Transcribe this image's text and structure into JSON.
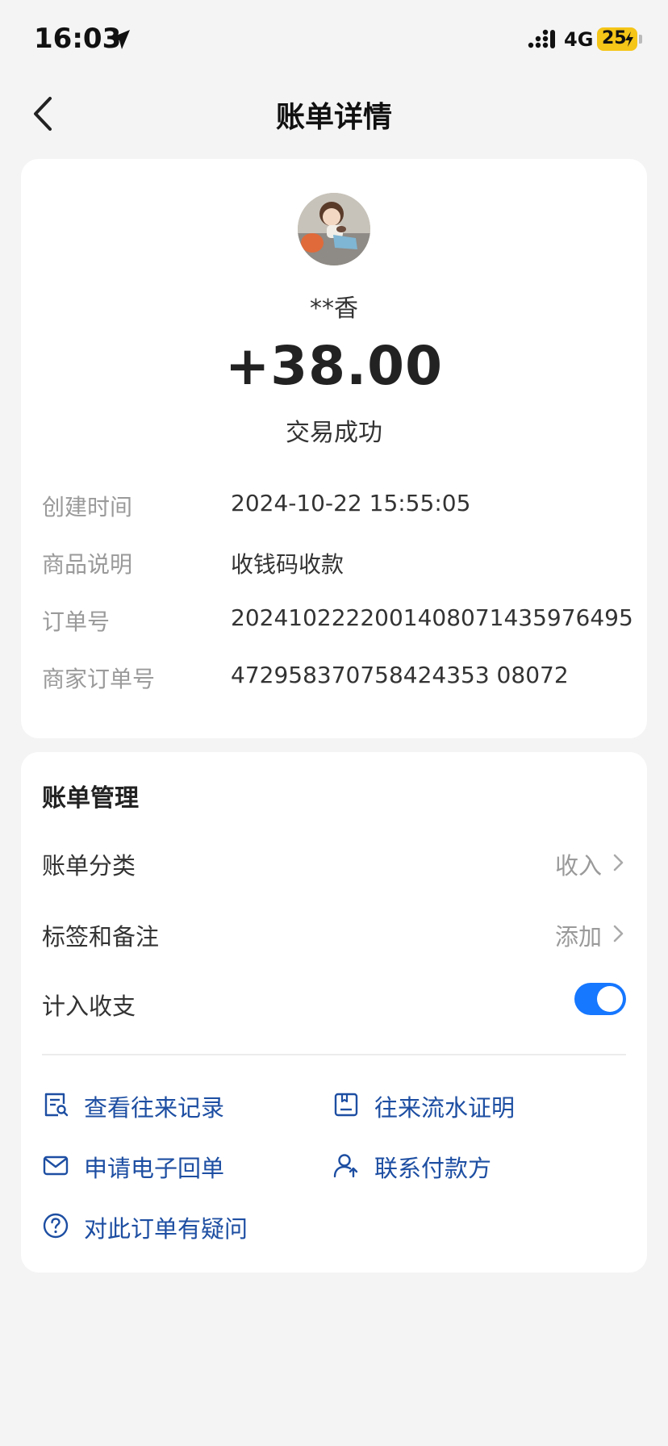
{
  "status_bar": {
    "time": "16:03",
    "network": "4G",
    "battery": "25",
    "icons": [
      "location-arrow-icon",
      "signal-icon",
      "bolt-icon"
    ],
    "battery_color": "#f5c518"
  },
  "nav": {
    "title": "账单详情",
    "back_icon": "chevron-left-icon"
  },
  "transaction": {
    "payee": "**香",
    "amount": "+38.00",
    "status": "交易成功",
    "details": [
      {
        "label": "创建时间",
        "value": "2024-10-22 15:55:05"
      },
      {
        "label": "商品说明",
        "value": "收钱码收款"
      },
      {
        "label": "订单号",
        "value": "2024102222001408071435976495"
      },
      {
        "label": "商家订单号",
        "value": "472958370758424353 08072"
      }
    ]
  },
  "manage": {
    "title": "账单管理",
    "category": {
      "label": "账单分类",
      "value": "收入"
    },
    "tags": {
      "label": "标签和备注",
      "value": "添加"
    },
    "include": {
      "label": "计入收支",
      "enabled": true
    },
    "actions": [
      {
        "label": "查看往来记录",
        "icon": "record-search-icon"
      },
      {
        "label": "往来流水证明",
        "icon": "statement-icon"
      },
      {
        "label": "申请电子回单",
        "icon": "envelope-icon"
      },
      {
        "label": "联系付款方",
        "icon": "contact-user-icon"
      },
      {
        "label": "对此订单有疑问",
        "icon": "question-circle-icon"
      }
    ]
  },
  "colors": {
    "link": "#1d4ea2",
    "toggle_on": "#1677ff",
    "background": "#f4f4f4"
  }
}
